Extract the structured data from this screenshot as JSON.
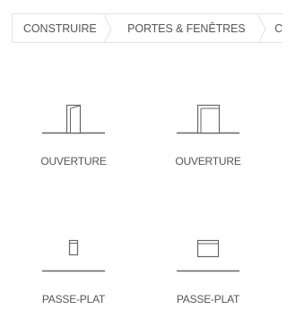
{
  "breadcrumb": {
    "items": [
      {
        "label": "CONSTRUIRE"
      },
      {
        "label": "PORTES & FENÊTRES"
      },
      {
        "label": "C"
      }
    ]
  },
  "items": [
    {
      "label": "OUVERTURE",
      "icon": "opening-door-icon"
    },
    {
      "label": "OUVERTURE",
      "icon": "opening-wide-icon"
    },
    {
      "label": "PASSE-PLAT",
      "icon": "pass-through-icon"
    },
    {
      "label": "PASSE-PLAT",
      "icon": "pass-through-wide-icon"
    }
  ]
}
